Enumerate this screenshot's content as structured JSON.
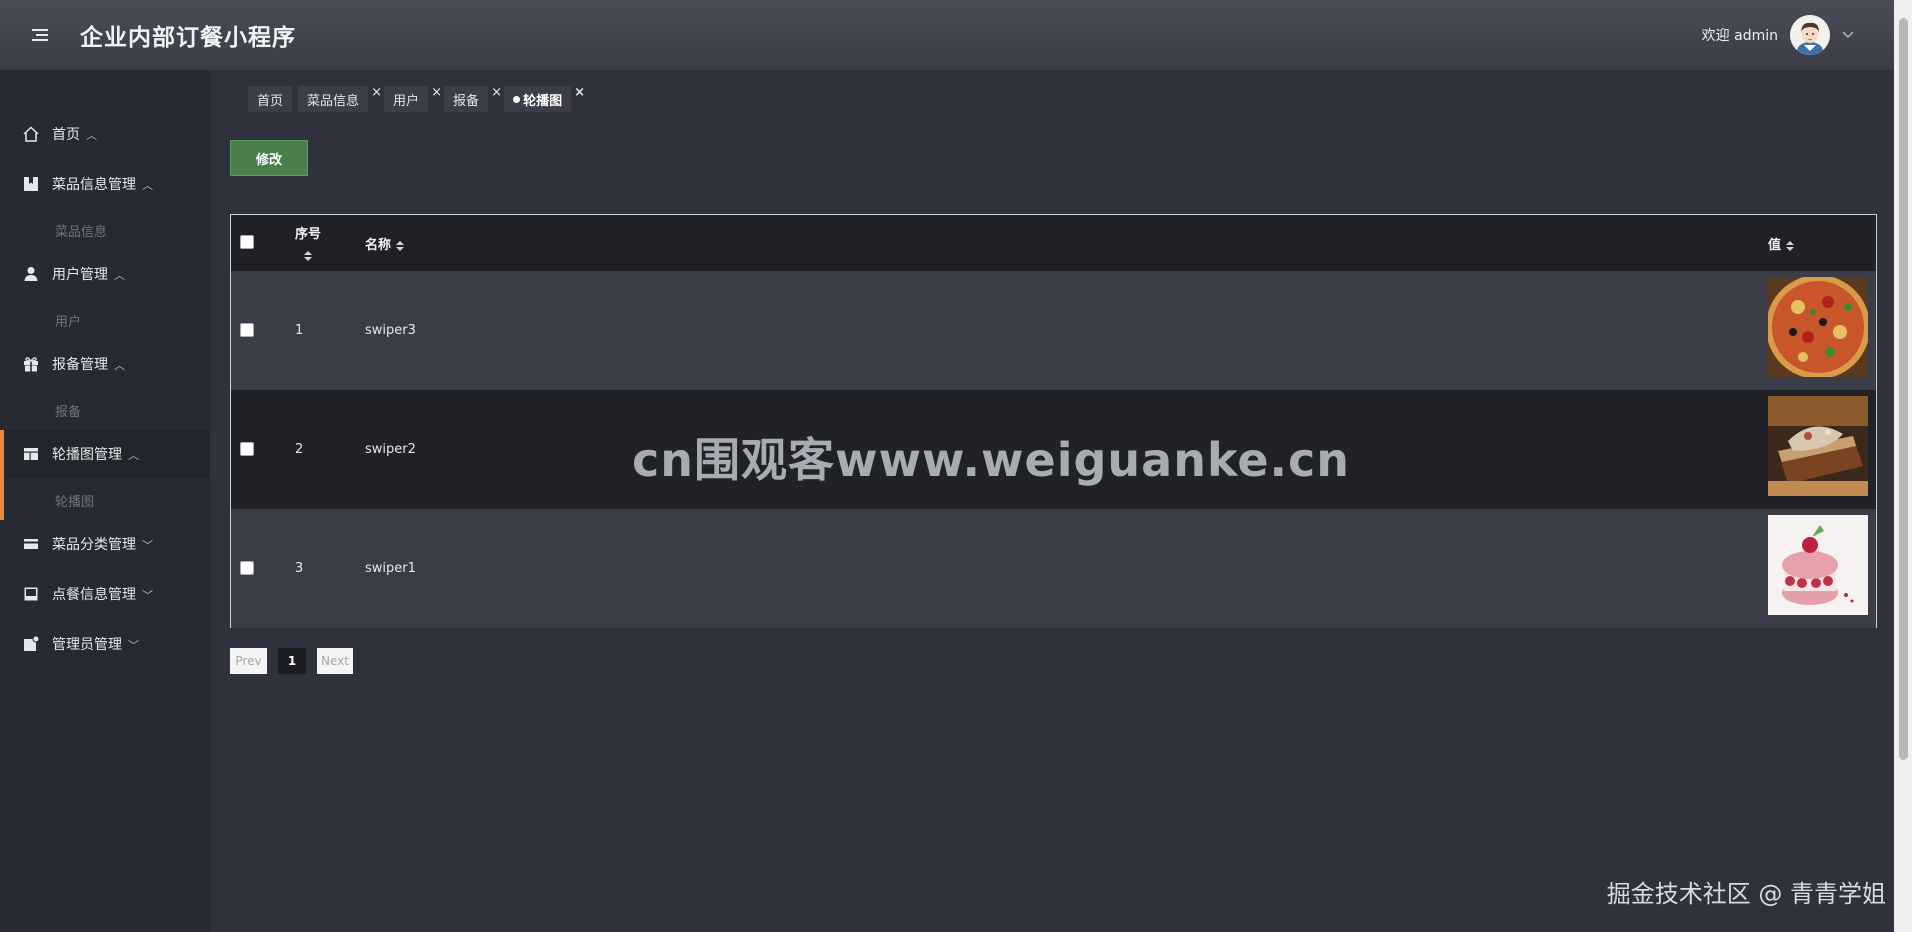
{
  "header": {
    "app_title": "企业内部订餐小程序",
    "welcome": "欢迎 admin"
  },
  "sidebar": {
    "items": [
      {
        "label": "首页",
        "arrow": "^",
        "icon": "home-icon"
      },
      {
        "label": "菜品信息管理",
        "arrow": "^",
        "icon": "bookmark-icon",
        "sub": "菜品信息"
      },
      {
        "label": "用户管理",
        "arrow": "^",
        "icon": "user-icon",
        "sub": "用户"
      },
      {
        "label": "报备管理",
        "arrow": "^",
        "icon": "gift-icon",
        "sub": "报备"
      },
      {
        "label": "轮播图管理",
        "arrow": "^",
        "icon": "table-icon",
        "sub": "轮播图"
      },
      {
        "label": "菜品分类管理",
        "arrow": "v",
        "icon": "card-icon"
      },
      {
        "label": "点餐信息管理",
        "arrow": "v",
        "icon": "inbox-icon"
      },
      {
        "label": "管理员管理",
        "arrow": "v",
        "icon": "admin-icon"
      }
    ]
  },
  "tabs": [
    {
      "label": "首页"
    },
    {
      "label": "菜品信息",
      "close": "×"
    },
    {
      "label": "用户",
      "close": "×"
    },
    {
      "label": "报备",
      "close": "×"
    },
    {
      "label": "轮播图",
      "close": "×",
      "current": true
    }
  ],
  "toolbar": {
    "edit_label": "修改"
  },
  "table": {
    "headers": {
      "index": "序号",
      "name": "名称",
      "value": "值"
    },
    "rows": [
      {
        "index": "1",
        "name": "swiper3",
        "image": "pizza"
      },
      {
        "index": "2",
        "name": "swiper2",
        "image": "cake-slice"
      },
      {
        "index": "3",
        "name": "swiper1",
        "image": "macaron"
      }
    ]
  },
  "pager": {
    "prev": "Prev",
    "current": "1",
    "next": "Next"
  },
  "watermarks": {
    "center": "cn围观客www.weiguanke.cn",
    "corner": "掘金技术社区 @ 青青学姐"
  },
  "colors": {
    "accent": "#e8893d",
    "edit_button": "#4a7f4c",
    "header": "#3a3c47",
    "sidebar": "#282a33"
  }
}
